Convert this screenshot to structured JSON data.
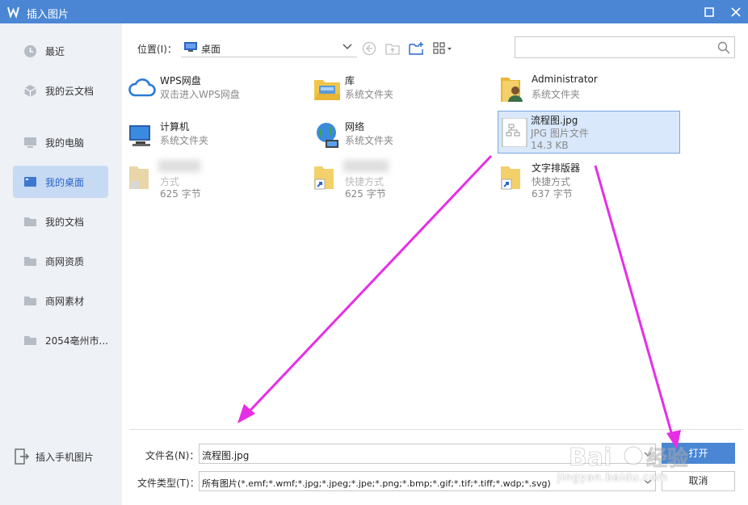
{
  "window": {
    "title": "插入图片"
  },
  "sidebar": {
    "items": [
      {
        "label": "最近",
        "icon": "clock-icon",
        "active": false
      },
      {
        "label": "我的云文档",
        "icon": "cloud-cube-icon",
        "active": false
      },
      {
        "label": "我的电脑",
        "icon": "monitor-icon",
        "active": false
      },
      {
        "label": "我的桌面",
        "icon": "desktop-icon",
        "active": true
      },
      {
        "label": "我的文档",
        "icon": "folder-icon",
        "active": false
      },
      {
        "label": "商网资质",
        "icon": "folder-icon",
        "active": false
      },
      {
        "label": "商网素材",
        "icon": "folder-icon",
        "active": false
      },
      {
        "label": "2054亳州市...",
        "icon": "folder-icon",
        "active": false
      }
    ],
    "bottom_label": "插入手机图片"
  },
  "toolbar": {
    "location_label": "位置(I)：",
    "location_value": "桌面",
    "search_placeholder": ""
  },
  "files": [
    {
      "name": "WPS网盘",
      "sub": "双击进入WPS网盘",
      "sub2": "",
      "icon": "cloud-icon"
    },
    {
      "name": "库",
      "sub": "系统文件夹",
      "sub2": "",
      "icon": "library-folder-icon"
    },
    {
      "name": "Administrator",
      "sub": "系统文件夹",
      "sub2": "",
      "icon": "user-folder-icon"
    },
    {
      "name": "计算机",
      "sub": "系统文件夹",
      "sub2": "",
      "icon": "computer-icon"
    },
    {
      "name": "网络",
      "sub": "系统文件夹",
      "sub2": "",
      "icon": "network-icon"
    },
    {
      "name": "流程图.jpg",
      "sub": "JPG 图片文件",
      "sub2": "14.3 KB",
      "icon": "image-file-icon"
    },
    {
      "name": "",
      "sub": "方式",
      "sub2": "625 字节",
      "icon": "shortcut-folder-icon"
    },
    {
      "name": "",
      "sub": "快捷方式",
      "sub2": "625 字节",
      "icon": "shortcut-folder-icon"
    },
    {
      "name": "文字排版器",
      "sub": "快捷方式",
      "sub2": "637 字节",
      "icon": "shortcut-folder-icon"
    }
  ],
  "bottom": {
    "filename_label": "文件名(N)：",
    "filename_value": "流程图.jpg",
    "filetype_label": "文件类型(T)：",
    "filetype_value": "所有图片(*.emf;*.wmf;*.jpg;*.jpeg;*.jpe;*.png;*.bmp;*.gif;*.tif;*.tiff;*.wdp;*.svg)",
    "open_label": "打开",
    "cancel_label": "取消"
  },
  "watermark": {
    "text": "jingyan.baidu.com"
  },
  "colors": {
    "accent": "#4a86d4",
    "annotation": "#e62ee6",
    "sidebar_bg": "#eef1f6",
    "selected_bg": "#d9e8fb"
  }
}
